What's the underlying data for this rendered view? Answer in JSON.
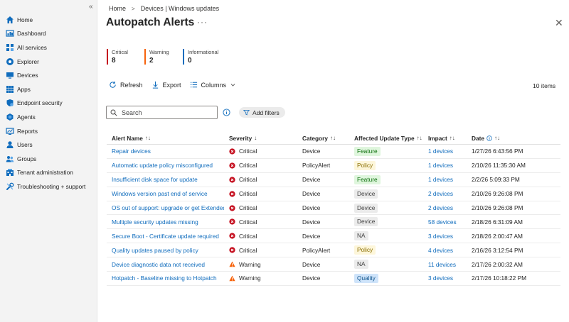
{
  "sidebar": {
    "collapse_glyph": "«",
    "items": [
      {
        "label": "Home",
        "icon": "home-icon"
      },
      {
        "label": "Dashboard",
        "icon": "dashboard-icon"
      },
      {
        "label": "All services",
        "icon": "all-services-icon"
      },
      {
        "label": "Explorer",
        "icon": "explorer-icon"
      },
      {
        "label": "Devices",
        "icon": "devices-icon"
      },
      {
        "label": "Apps",
        "icon": "apps-icon"
      },
      {
        "label": "Endpoint security",
        "icon": "endpoint-security-icon"
      },
      {
        "label": "Agents",
        "icon": "agents-icon"
      },
      {
        "label": "Reports",
        "icon": "reports-icon"
      },
      {
        "label": "Users",
        "icon": "users-icon"
      },
      {
        "label": "Groups",
        "icon": "groups-icon"
      },
      {
        "label": "Tenant administration",
        "icon": "tenant-admin-icon"
      },
      {
        "label": "Troubleshooting + support",
        "icon": "troubleshooting-icon"
      }
    ]
  },
  "breadcrumb": {
    "home": "Home",
    "sep": ">",
    "current": "Devices | Windows updates"
  },
  "page": {
    "title": "Autopatch Alerts",
    "more": "···",
    "close": "✕"
  },
  "summary": {
    "critical": {
      "label": "Critical",
      "value": "8"
    },
    "warning": {
      "label": "Warning",
      "value": "2"
    },
    "informational": {
      "label": "Informational",
      "value": "0"
    }
  },
  "toolbar": {
    "refresh": "Refresh",
    "export": "Export",
    "columns": "Columns",
    "items_count": "10 items"
  },
  "search": {
    "placeholder": "Search"
  },
  "filters": {
    "add_filters": "Add filters"
  },
  "table": {
    "headers": {
      "alert_name": "Alert Name",
      "severity": "Severity",
      "category": "Category",
      "affected_update_type": "Affected Update Type",
      "impact": "Impact",
      "date": "Date"
    },
    "rows": [
      {
        "alert_name": "Repair devices",
        "severity": "Critical",
        "category": "Device",
        "update_type": "Feature",
        "impact": "1 devices",
        "date": "1/27/26 6:43:56 PM"
      },
      {
        "alert_name": "Automatic update policy misconfigured",
        "severity": "Critical",
        "category": "PolicyAlert",
        "update_type": "Policy",
        "impact": "1 devices",
        "date": "2/10/26 11:35:30 AM"
      },
      {
        "alert_name": "Insufficient disk space for update",
        "severity": "Critical",
        "category": "Device",
        "update_type": "Feature",
        "impact": "1 devices",
        "date": "2/2/26 5:09:33 PM"
      },
      {
        "alert_name": "Windows version past end of service",
        "severity": "Critical",
        "category": "Device",
        "update_type": "Device",
        "impact": "2 devices",
        "date": "2/10/26 9:26:08 PM"
      },
      {
        "alert_name": "OS out of support: upgrade or get Extended Security Updates",
        "severity": "Critical",
        "category": "Device",
        "update_type": "Device",
        "impact": "2 devices",
        "date": "2/10/26 9:26:08 PM"
      },
      {
        "alert_name": "Multiple security updates missing",
        "severity": "Critical",
        "category": "Device",
        "update_type": "Device",
        "impact": "58 devices",
        "date": "2/18/26 6:31:09 AM"
      },
      {
        "alert_name": "Secure Boot - Certificate update required",
        "severity": "Critical",
        "category": "Device",
        "update_type": "NA",
        "impact": "3 devices",
        "date": "2/18/26 2:00:47 AM"
      },
      {
        "alert_name": "Quality updates paused by policy",
        "severity": "Critical",
        "category": "PolicyAlert",
        "update_type": "Policy",
        "impact": "4 devices",
        "date": "2/16/26 3:12:54 PM"
      },
      {
        "alert_name": "Device diagnostic data not received",
        "severity": "Warning",
        "category": "Device",
        "update_type": "NA",
        "impact": "11 devices",
        "date": "2/17/26 2:00:32 AM"
      },
      {
        "alert_name": "Hotpatch - Baseline missing to Hotpatch",
        "severity": "Warning",
        "category": "Device",
        "update_type": "Quality",
        "impact": "3 devices",
        "date": "2/17/26 10:18:22 PM"
      }
    ]
  },
  "colors": {
    "critical": "#c50f1f",
    "warning": "#f7630c",
    "informational": "#0f6cbd",
    "link": "#0f6cbd"
  }
}
